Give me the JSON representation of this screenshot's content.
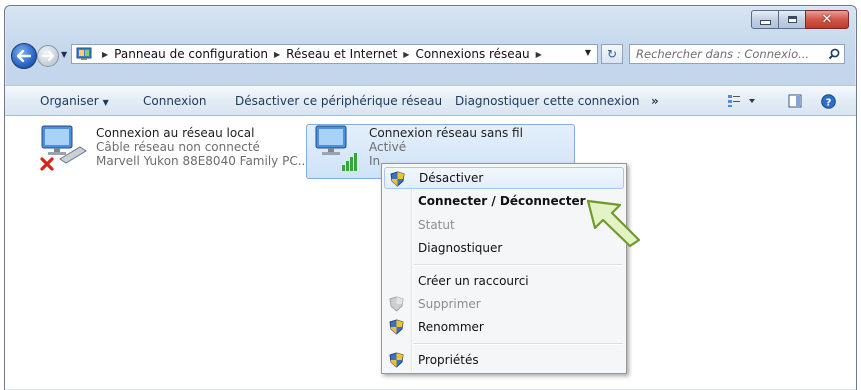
{
  "window": {
    "caption_buttons": [
      "minimize-icon",
      "maximize-icon",
      "close-icon"
    ]
  },
  "nav": {
    "breadcrumbs": [
      "Panneau de configuration",
      "Réseau et Internet",
      "Connexions réseau"
    ],
    "search_placeholder": "Rechercher dans : Connexio..."
  },
  "toolbar": {
    "organize": "Organiser",
    "connect": "Connexion",
    "disable_device": "Désactiver ce périphérique réseau",
    "diagnose": "Diagnostiquer cette connexion",
    "more": "»"
  },
  "connections": [
    {
      "name": "Connexion au réseau local",
      "status": "Câble réseau non connecté",
      "device": "Marvell Yukon 88E8040 Family PC..."
    },
    {
      "name": "Connexion réseau sans fil",
      "status": "Activé",
      "device": "In"
    }
  ],
  "context_menu": {
    "items": [
      {
        "label": "Désactiver",
        "icon": "shield-icon",
        "state": "hover"
      },
      {
        "label": "Connecter / Déconnecter",
        "icon": "",
        "state": "default-bold"
      },
      {
        "label": "Statut",
        "icon": "",
        "state": "disabled"
      },
      {
        "label": "Diagnostiquer",
        "icon": "",
        "state": "normal"
      },
      {
        "label": "Créer un raccourci",
        "icon": "",
        "state": "normal"
      },
      {
        "label": "Supprimer",
        "icon": "shield-icon",
        "state": "disabled"
      },
      {
        "label": "Renommer",
        "icon": "shield-icon",
        "state": "normal"
      },
      {
        "label": "Propriétés",
        "icon": "shield-icon",
        "state": "normal"
      }
    ]
  },
  "colors": {
    "accent": "#2a65c7",
    "pointer_fill": "#e4f3c6",
    "pointer_stroke": "#6f9a2c",
    "error_x": "#d4261c"
  }
}
